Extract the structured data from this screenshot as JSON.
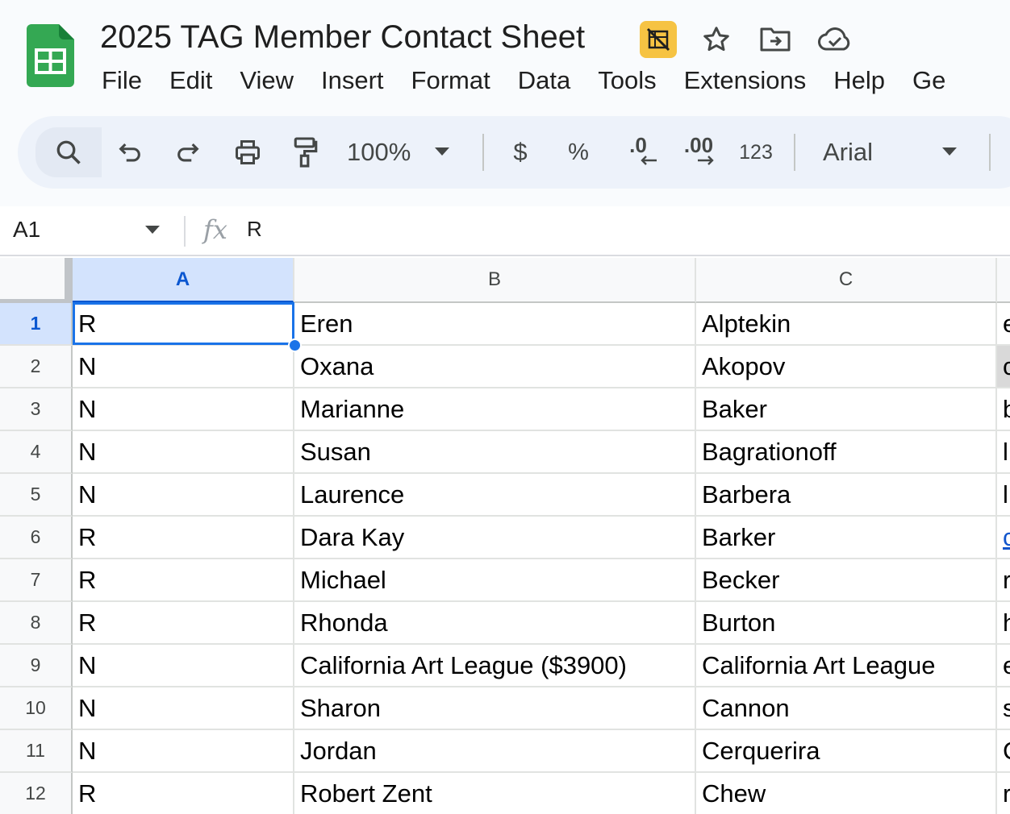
{
  "app": {
    "title": "2025 TAG Member Contact Sheet",
    "accent": "#0b57d0",
    "logo_color": "#34a853"
  },
  "title_icons": [
    "no-offline-icon",
    "star-icon",
    "move-to-folder-icon",
    "cloud-saved-icon"
  ],
  "menu": [
    "File",
    "Edit",
    "View",
    "Insert",
    "Format",
    "Data",
    "Tools",
    "Extensions",
    "Help",
    "Ge"
  ],
  "toolbar": {
    "zoom": "100%",
    "currency": "$",
    "percent": "%",
    "decrease_decimal": ".0",
    "increase_decimal": ".00",
    "number_format": "123",
    "font": "Arial"
  },
  "formula_bar": {
    "cell_ref": "A1",
    "value": "R"
  },
  "columns": [
    "A",
    "B",
    "C"
  ],
  "rows": [
    {
      "num": "1",
      "a": "R",
      "b": "Eren",
      "c": "Alptekin",
      "d": "e"
    },
    {
      "num": "2",
      "a": "N",
      "b": "Oxana",
      "c": "Akopov",
      "d": "c"
    },
    {
      "num": "3",
      "a": "N",
      "b": "Marianne",
      "c": "Baker",
      "d": "b"
    },
    {
      "num": "4",
      "a": "N",
      "b": "Susan",
      "c": "Bagrationoff",
      "d": "l"
    },
    {
      "num": "5",
      "a": "N",
      "b": "Laurence",
      "c": "Barbera",
      "d": "l"
    },
    {
      "num": "6",
      "a": "R",
      "b": "Dara Kay",
      "c": "Barker",
      "d": "c"
    },
    {
      "num": "7",
      "a": "R",
      "b": "Michael",
      "c": "Becker",
      "d": "r"
    },
    {
      "num": "8",
      "a": "R",
      "b": "Rhonda",
      "c": "Burton",
      "d": "h"
    },
    {
      "num": "9",
      "a": "N",
      "b": "California Art League ($3900)",
      "c": "California Art League",
      "d": "e"
    },
    {
      "num": "10",
      "a": "N",
      "b": "Sharon",
      "c": "Cannon",
      "d": "s"
    },
    {
      "num": "11",
      "a": "N",
      "b": "Jordan",
      "c": "Cerquerira",
      "d": "C"
    },
    {
      "num": "12",
      "a": "R",
      "b": "Robert Zent",
      "c": "Chew",
      "d": "r"
    }
  ]
}
